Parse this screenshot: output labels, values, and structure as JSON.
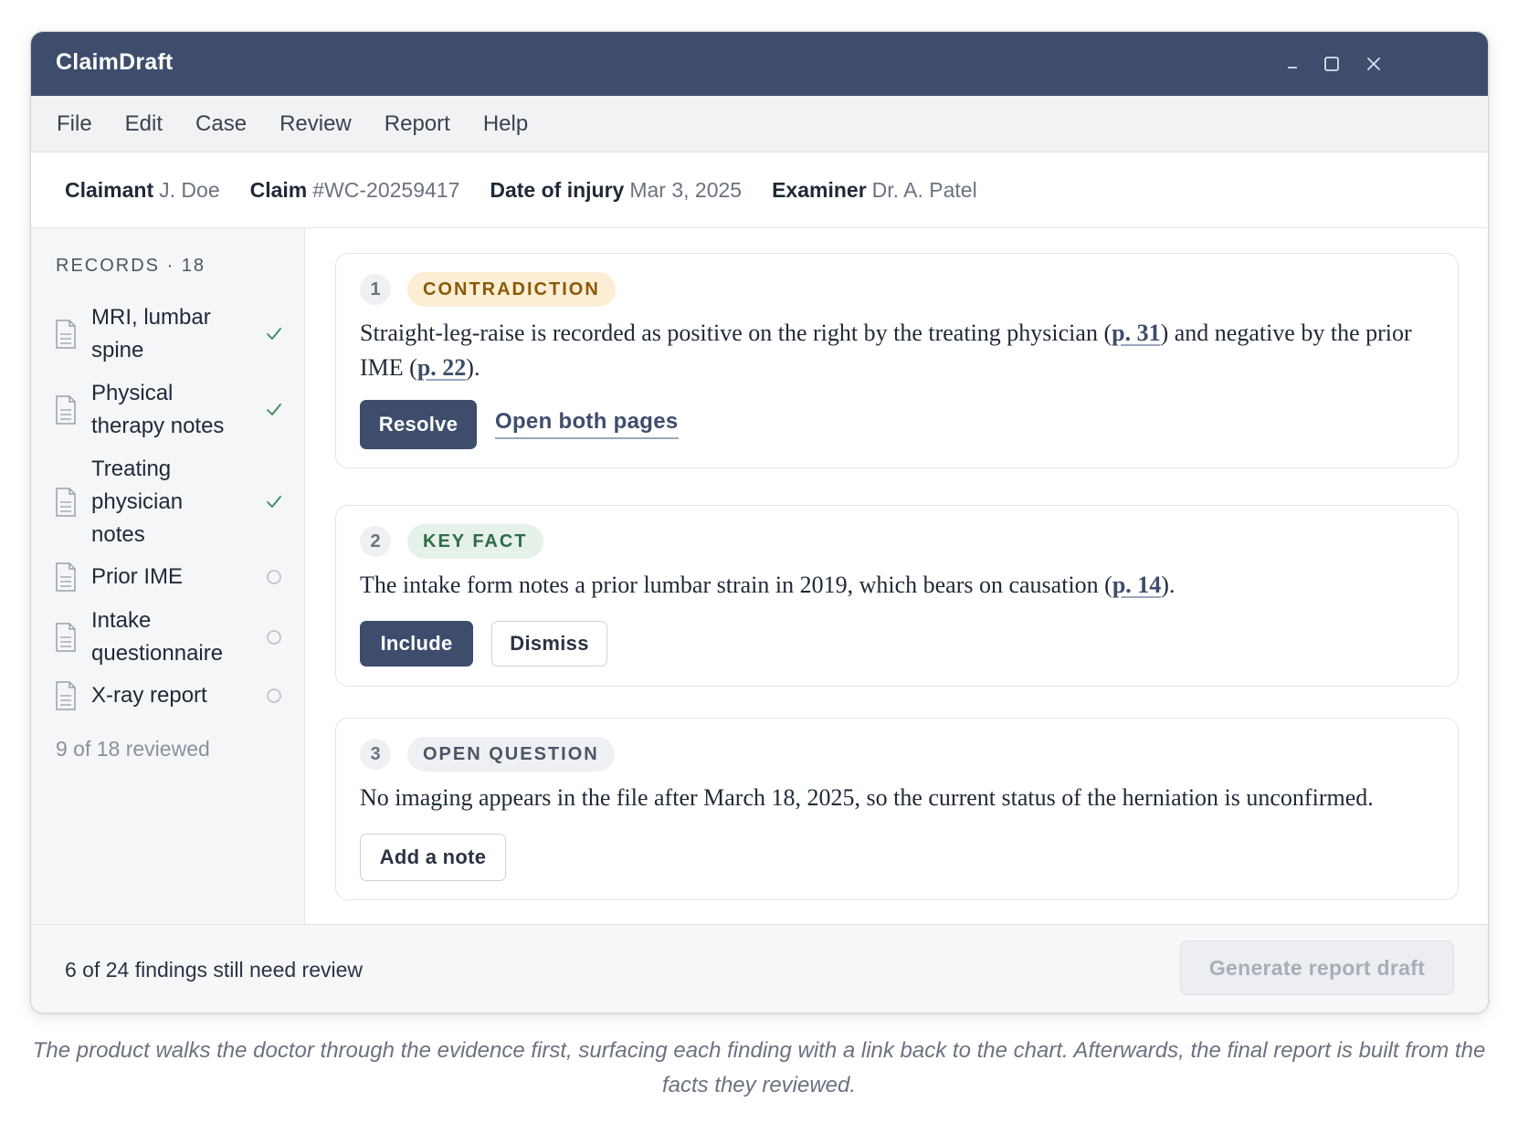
{
  "window": {
    "title": "ClaimDraft"
  },
  "menu": [
    "File",
    "Edit",
    "Case",
    "Review",
    "Report",
    "Help"
  ],
  "case": {
    "claimant_label": "Claimant",
    "claimant_value": "J. Doe",
    "claim_label": "Claim",
    "claim_value": "#WC-20259417",
    "injury_label": "Date of injury",
    "injury_value": "Mar 3, 2025",
    "examiner_label": "Examiner",
    "examiner_value": "Dr. A. Patel"
  },
  "sidebar": {
    "heading": "RECORDS · 18",
    "records": [
      {
        "lines": [
          "MRI, lumbar",
          "spine"
        ],
        "status": "reviewed"
      },
      {
        "lines": [
          "Physical",
          "therapy notes"
        ],
        "status": "reviewed"
      },
      {
        "lines": [
          "Treating",
          "physician",
          "notes"
        ],
        "status": "reviewed"
      },
      {
        "lines": [
          "Prior IME"
        ],
        "status": "pending"
      },
      {
        "lines": [
          "Intake",
          "questionnaire"
        ],
        "status": "pending"
      },
      {
        "lines": [
          "X-ray report"
        ],
        "status": "pending"
      }
    ],
    "progress": "9 of 18 reviewed"
  },
  "findings": [
    {
      "number": "1",
      "tag": "CONTRADICTION",
      "text_1": "Straight-leg-raise is recorded as positive on the right by the treating physician (",
      "ref_1": "p. 31",
      "text_2": ") and negative by the prior IME (",
      "ref_2": "p. 22",
      "text_3": ").",
      "primary_action": "Resolve",
      "link_action": "Open both pages"
    },
    {
      "number": "2",
      "tag": "KEY FACT",
      "text_1": "The intake form notes a prior lumbar strain in 2019, which bears on causation (",
      "ref_1": "p. 14",
      "text_2": ").",
      "primary_action": "Include",
      "secondary_action": "Dismiss"
    },
    {
      "number": "3",
      "tag": "OPEN QUESTION",
      "text_1": "No imaging appears in the file after March 18, 2025, so the current status of the herniation is unconfirmed.",
      "secondary_action": "Add a note"
    }
  ],
  "footer": {
    "remaining": "6 of 24 findings still need review",
    "generate": "Generate report draft"
  },
  "caption": "The product walks the doctor through the evidence first, surfacing each finding with a link back to the chart. Afterwards, the final report is built from the facts they reviewed.",
  "colors": {
    "titlebar": "#3d4d6b",
    "primary_button": "#3d4d6b",
    "check": "#3a8a5a",
    "contradiction_bg": "#fbeed4",
    "keyfact_bg": "#e6f1ea"
  }
}
